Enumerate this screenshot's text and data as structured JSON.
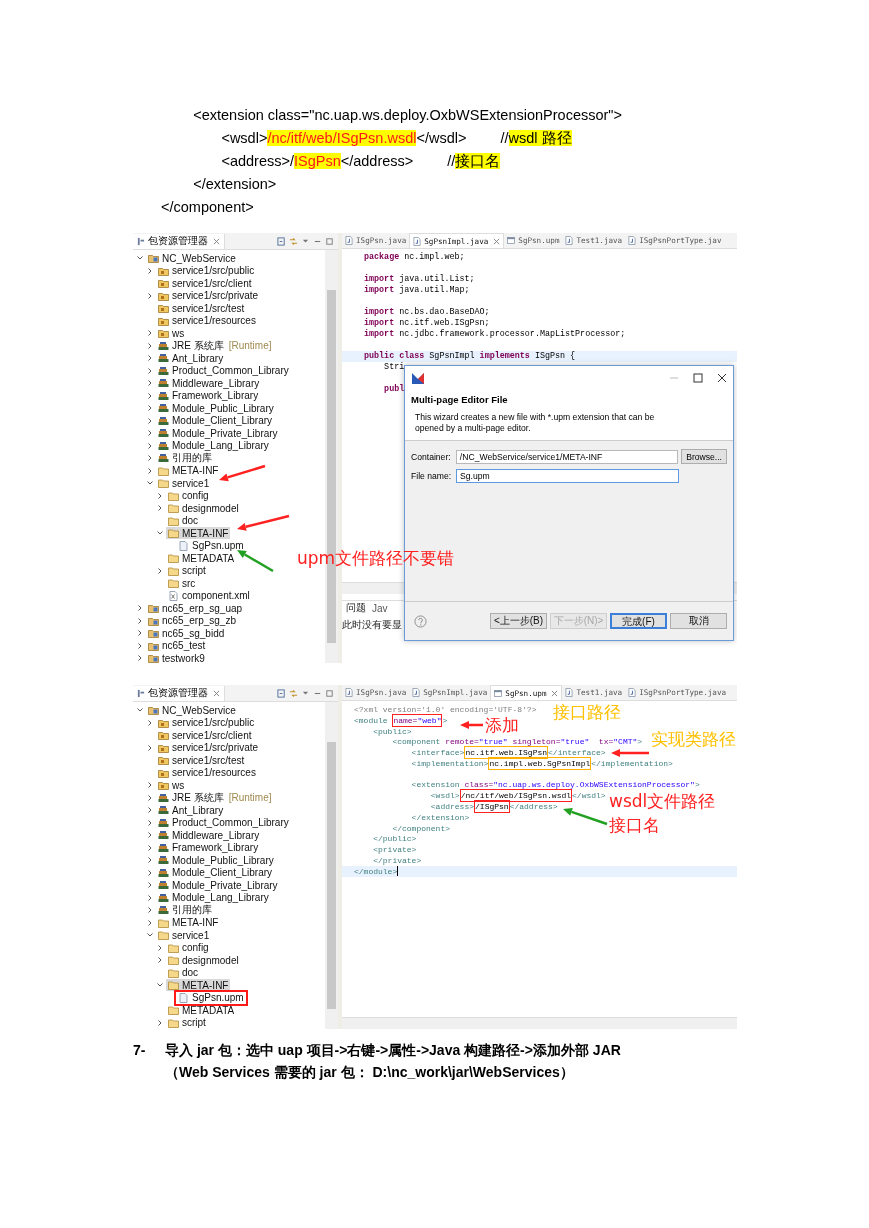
{
  "snippet": [
    {
      "segs": [
        {
          "text": "        <extension class=\"nc.uap.ws.deploy.OxbWSExtensionProcessor\">",
          "kind": "code"
        }
      ]
    },
    {
      "segs": [
        {
          "text": "               <wsdl>",
          "kind": "code"
        },
        {
          "text": "/nc/itf/web/ISgPsn.wsdl",
          "kind": "red"
        },
        {
          "text": "</wsdl>",
          "kind": "code"
        }
      ],
      "note": [
        {
          "text": "//",
          "kind": "code"
        },
        {
          "text": "wsdl 路径",
          "kind": "mark"
        }
      ]
    },
    {
      "segs": [
        {
          "text": "               <address>/",
          "kind": "code"
        },
        {
          "text": "ISgPsn",
          "kind": "red"
        },
        {
          "text": "</address>",
          "kind": "code"
        }
      ],
      "note": [
        {
          "text": "//",
          "kind": "code"
        },
        {
          "text": "接口名",
          "kind": "mark"
        }
      ]
    },
    {
      "segs": [
        {
          "text": "        </extension>",
          "kind": "code"
        }
      ]
    },
    {
      "segs": [
        {
          "text": "</component>",
          "kind": "code"
        }
      ]
    }
  ],
  "shot1": {
    "explorer_title": "包资源管理器",
    "tree": [
      {
        "label": "NC_WebService",
        "kind": "project",
        "expanded": true,
        "selected": false,
        "children": [
          {
            "label": "service1/src/public",
            "kind": "source-folder",
            "expanded": false,
            "selected": false
          },
          {
            "label": "service1/src/client",
            "kind": "source-folder",
            "selected": false
          },
          {
            "label": "service1/src/private",
            "kind": "source-folder",
            "expanded": false,
            "selected": false
          },
          {
            "label": "service1/src/test",
            "kind": "source-folder",
            "selected": false
          },
          {
            "label": "service1/resources",
            "kind": "source-folder",
            "selected": false
          },
          {
            "label": "ws",
            "kind": "source-folder",
            "expanded": false,
            "selected": false
          },
          {
            "label": "JRE 系统库",
            "decoration": "[Runtime]",
            "kind": "library",
            "expanded": false,
            "selected": false
          },
          {
            "label": "Ant_Library",
            "kind": "library",
            "expanded": false,
            "selected": false
          },
          {
            "label": "Product_Common_Library",
            "kind": "library",
            "expanded": false,
            "selected": false
          },
          {
            "label": "Middleware_Library",
            "kind": "library",
            "expanded": false,
            "selected": false
          },
          {
            "label": "Framework_Library",
            "kind": "library",
            "expanded": false,
            "selected": false
          },
          {
            "label": "Module_Public_Library",
            "kind": "library",
            "expanded": false,
            "selected": false
          },
          {
            "label": "Module_Client_Library",
            "kind": "library",
            "expanded": false,
            "selected": false
          },
          {
            "label": "Module_Private_Library",
            "kind": "library",
            "expanded": false,
            "selected": false
          },
          {
            "label": "Module_Lang_Library",
            "kind": "library",
            "expanded": false,
            "selected": false
          },
          {
            "label": "引用的库",
            "kind": "library",
            "expanded": false,
            "selected": false
          },
          {
            "label": "META-INF",
            "kind": "folder",
            "expanded": false,
            "selected": false
          },
          {
            "label": "service1",
            "kind": "folder",
            "expanded": true,
            "selected": false,
            "children": [
              {
                "label": "config",
                "kind": "folder",
                "expanded": false,
                "selected": false
              },
              {
                "label": "designmodel",
                "kind": "folder",
                "expanded": false,
                "selected": false
              },
              {
                "label": "doc",
                "kind": "folder",
                "selected": false
              },
              {
                "label": "META-INF",
                "kind": "folder",
                "expanded": true,
                "selected": true,
                "children": [
                  {
                    "label": "SgPsn.upm",
                    "kind": "file",
                    "selected": false
                  }
                ]
              },
              {
                "label": "METADATA",
                "kind": "folder",
                "selected": false
              },
              {
                "label": "script",
                "kind": "folder",
                "expanded": false,
                "selected": false
              },
              {
                "label": "src",
                "kind": "folder",
                "selected": false
              },
              {
                "label": "component.xml",
                "kind": "xml-file",
                "selected": false
              }
            ]
          }
        ]
      },
      {
        "label": "nc65_erp_sg_uap",
        "kind": "project",
        "expanded": false,
        "selected": false
      },
      {
        "label": "nc65_erp_sg_zb",
        "kind": "project",
        "expanded": false,
        "selected": false
      },
      {
        "label": "nc65_sg_bidd",
        "kind": "project",
        "expanded": false,
        "selected": false
      },
      {
        "label": "nc65_test",
        "kind": "project",
        "expanded": false,
        "selected": false
      },
      {
        "label": "testwork9",
        "kind": "project",
        "expanded": false,
        "selected": false
      }
    ],
    "tabs": [
      {
        "label": "ISgPsn.java",
        "kind": "java",
        "selected": false
      },
      {
        "label": "SgPsnImpl.java",
        "kind": "java",
        "selected": true
      },
      {
        "label": "SgPsn.upm",
        "kind": "upm",
        "selected": false
      },
      {
        "label": "Test1.java",
        "kind": "java",
        "selected": false
      },
      {
        "label": "ISgPsnPortType.jav",
        "kind": "java",
        "selected": false
      }
    ],
    "code": [
      {
        "current": false,
        "segs": [
          {
            "text": "package",
            "kind": "kw"
          },
          {
            "text": " nc.impl.web;",
            "kind": "plain"
          }
        ]
      },
      {
        "current": false
      },
      {
        "current": false,
        "segs": [
          {
            "text": "import",
            "kind": "kw"
          },
          {
            "text": " java.util.List;",
            "kind": "plain"
          }
        ]
      },
      {
        "current": false,
        "segs": [
          {
            "text": "import",
            "kind": "kw"
          },
          {
            "text": " java.util.Map;",
            "kind": "plain"
          }
        ]
      },
      {
        "current": false
      },
      {
        "current": false,
        "segs": [
          {
            "text": "import",
            "kind": "kw"
          },
          {
            "text": " nc.bs.dao.BaseDAO;",
            "kind": "plain"
          }
        ]
      },
      {
        "current": false,
        "segs": [
          {
            "text": "import",
            "kind": "kw"
          },
          {
            "text": " nc.itf.web.ISgPsn;",
            "kind": "plain"
          }
        ]
      },
      {
        "current": false,
        "segs": [
          {
            "text": "import",
            "kind": "kw"
          },
          {
            "text": " nc.jdbc.framework.processor.MapListProcessor;",
            "kind": "plain"
          }
        ]
      },
      {
        "current": false
      },
      {
        "current": true,
        "segs": [
          {
            "text": "public class",
            "kind": "kw"
          },
          {
            "text": " SgPsnImpl ",
            "kind": "plain"
          },
          {
            "text": "implements",
            "kind": "kw"
          },
          {
            "text": " ISgPsn {",
            "kind": "plain"
          }
        ]
      },
      {
        "current": false,
        "segs": [
          {
            "text": "    Stri",
            "kind": "plain"
          }
        ]
      },
      {
        "current": false
      },
      {
        "current": false,
        "segs": [
          {
            "text": "    publ",
            "kind": "kw"
          }
        ]
      }
    ],
    "problems": {
      "tabs": [
        {
          "label": "问题",
          "selected": true
        },
        {
          "label": "Jav",
          "selected": false
        }
      ],
      "message": "此时没有要显"
    },
    "dialog": {
      "heading": "Multi-page Editor File",
      "description": "This wizard creates a new file with *.upm extension that can be opened by a multi-page editor.",
      "fields": [
        {
          "label": "Container:",
          "value": "/NC_WebService/service1/META-INF",
          "focused": false
        },
        {
          "label": "File name:",
          "value": "Sg.upm",
          "focused": true
        }
      ],
      "browse": "Browse...",
      "buttons": [
        {
          "label": "<上一步(B)",
          "disabled": false,
          "default": false
        },
        {
          "label": "下一步(N)>",
          "disabled": true,
          "default": false
        },
        {
          "label": "完成(F)",
          "disabled": false,
          "default": true
        },
        {
          "label": "取消",
          "disabled": false,
          "default": false
        }
      ]
    },
    "annotations": [
      {
        "text": "upm文件路径不要错",
        "color": "#ff2020"
      }
    ]
  },
  "shot2": {
    "explorer_title": "包资源管理器",
    "tree": [
      {
        "label": "NC_WebService",
        "kind": "project",
        "expanded": true,
        "selected": false,
        "children": [
          {
            "label": "service1/src/public",
            "kind": "source-folder",
            "expanded": false,
            "selected": false
          },
          {
            "label": "service1/src/client",
            "kind": "source-folder",
            "selected": false
          },
          {
            "label": "service1/src/private",
            "kind": "source-folder",
            "expanded": false,
            "selected": false
          },
          {
            "label": "service1/src/test",
            "kind": "source-folder",
            "selected": false
          },
          {
            "label": "service1/resources",
            "kind": "source-folder",
            "selected": false
          },
          {
            "label": "ws",
            "kind": "source-folder",
            "expanded": false,
            "selected": false
          },
          {
            "label": "JRE 系统库",
            "decoration": "[Runtime]",
            "kind": "library",
            "expanded": false,
            "selected": false
          },
          {
            "label": "Ant_Library",
            "kind": "library",
            "expanded": false,
            "selected": false
          },
          {
            "label": "Product_Common_Library",
            "kind": "library",
            "expanded": false,
            "selected": false
          },
          {
            "label": "Middleware_Library",
            "kind": "library",
            "expanded": false,
            "selected": false
          },
          {
            "label": "Framework_Library",
            "kind": "library",
            "expanded": false,
            "selected": false
          },
          {
            "label": "Module_Public_Library",
            "kind": "library",
            "expanded": false,
            "selected": false
          },
          {
            "label": "Module_Client_Library",
            "kind": "library",
            "expanded": false,
            "selected": false
          },
          {
            "label": "Module_Private_Library",
            "kind": "library",
            "expanded": false,
            "selected": false
          },
          {
            "label": "Module_Lang_Library",
            "kind": "library",
            "expanded": false,
            "selected": false
          },
          {
            "label": "引用的库",
            "kind": "library",
            "expanded": false,
            "selected": false
          },
          {
            "label": "META-INF",
            "kind": "folder",
            "expanded": false,
            "selected": false
          },
          {
            "label": "service1",
            "kind": "folder",
            "expanded": true,
            "selected": false,
            "children": [
              {
                "label": "config",
                "kind": "folder",
                "expanded": false,
                "selected": false
              },
              {
                "label": "designmodel",
                "kind": "folder",
                "expanded": false,
                "selected": false
              },
              {
                "label": "doc",
                "kind": "folder",
                "selected": false
              },
              {
                "label": "META-INF",
                "kind": "folder",
                "expanded": true,
                "selected": true,
                "children": [
                  {
                    "label": "SgPsn.upm",
                    "kind": "file",
                    "selected": false,
                    "boxed": true
                  }
                ]
              },
              {
                "label": "METADATA",
                "kind": "folder",
                "selected": false
              },
              {
                "label": "script",
                "kind": "folder",
                "expanded": false,
                "selected": false
              }
            ]
          }
        ]
      }
    ],
    "tabs": [
      {
        "label": "ISgPsn.java",
        "kind": "java",
        "selected": false
      },
      {
        "label": "SgPsnImpl.java",
        "kind": "java",
        "selected": false
      },
      {
        "label": "SgPsn.upm",
        "kind": "upm",
        "selected": true
      },
      {
        "label": "Test1.java",
        "kind": "java",
        "selected": false
      },
      {
        "label": "ISgPsnPortType.java",
        "kind": "java",
        "selected": false
      }
    ],
    "code": [
      {
        "current": false,
        "segs": [
          {
            "text": "<?xml version='1.0' encoding='UTF-8'?>",
            "kind": "decl"
          }
        ]
      },
      {
        "current": false,
        "segs": [
          {
            "text": "<module ",
            "kind": "tag"
          },
          {
            "color": "#ff2020",
            "parts": [
              {
                "text": "name=",
                "kind": "attr"
              },
              {
                "text": "\"web\"",
                "kind": "val"
              }
            ]
          },
          {
            "text": ">",
            "kind": "tag"
          }
        ]
      },
      {
        "current": false,
        "segs": [
          {
            "text": "    <public>",
            "kind": "tag"
          }
        ]
      },
      {
        "current": false,
        "segs": [
          {
            "text": "        <component ",
            "kind": "tag"
          },
          {
            "text": "remote=",
            "kind": "attr"
          },
          {
            "text": "\"true\"",
            "kind": "val"
          },
          {
            "text": " singleton=",
            "kind": "attr"
          },
          {
            "text": "\"true\"",
            "kind": "val"
          },
          {
            "text": "  tx=",
            "kind": "attr"
          },
          {
            "text": "\"CMT\"",
            "kind": "val"
          },
          {
            "text": ">",
            "kind": "tag"
          }
        ]
      },
      {
        "current": false,
        "segs": [
          {
            "text": "            <interface>",
            "kind": "tag"
          },
          {
            "color": "#ffb000",
            "parts": [
              {
                "text": "nc.itf.web.ISgPsn",
                "kind": "text"
              }
            ]
          },
          {
            "text": "</interface>",
            "kind": "tag"
          }
        ]
      },
      {
        "current": false,
        "segs": [
          {
            "text": "            <implementation>",
            "kind": "tag"
          },
          {
            "color": "#ffb000",
            "parts": [
              {
                "text": "nc.impl.web.SgPsnImpl",
                "kind": "text"
              }
            ]
          },
          {
            "text": "</implementation>",
            "kind": "tag"
          }
        ]
      },
      {
        "current": false
      },
      {
        "current": false,
        "segs": [
          {
            "text": "            <extension ",
            "kind": "tag"
          },
          {
            "text": "class=",
            "kind": "attr"
          },
          {
            "text": "\"nc.uap.ws.deploy.OxbWSExtensionProcessor\"",
            "kind": "val"
          },
          {
            "text": ">",
            "kind": "tag"
          }
        ]
      },
      {
        "current": false,
        "segs": [
          {
            "text": "                <wsdl>",
            "kind": "tag"
          },
          {
            "color": "#ff2020",
            "parts": [
              {
                "text": "/nc/itf/web/ISgPsn.wsdl",
                "kind": "text"
              }
            ]
          },
          {
            "text": "</wsdl>",
            "kind": "tag"
          }
        ]
      },
      {
        "current": false,
        "segs": [
          {
            "text": "                <address>",
            "kind": "tag"
          },
          {
            "color": "#ff2020",
            "parts": [
              {
                "text": "/ISgPsn",
                "kind": "text"
              }
            ]
          },
          {
            "text": "</address>",
            "kind": "tag"
          }
        ]
      },
      {
        "current": false,
        "segs": [
          {
            "text": "            </extension>",
            "kind": "tag"
          }
        ]
      },
      {
        "current": false,
        "segs": [
          {
            "text": "        </component>",
            "kind": "tag"
          }
        ]
      },
      {
        "current": false,
        "segs": [
          {
            "text": "    </public>",
            "kind": "tag"
          }
        ]
      },
      {
        "current": false,
        "segs": [
          {
            "text": "    <private>",
            "kind": "tag"
          }
        ]
      },
      {
        "current": false,
        "segs": [
          {
            "text": "    </private>",
            "kind": "tag"
          }
        ]
      },
      {
        "current": true,
        "segs": [
          {
            "text": "</module>",
            "kind": "tag"
          }
        ]
      }
    ],
    "annotations": [
      {
        "text": "添加",
        "color": "#ff2020"
      },
      {
        "text": "接口路径",
        "color": "#ffc000"
      },
      {
        "text": "实现类路径",
        "color": "#ffc000"
      },
      {
        "text": "wsdl文件路径",
        "color": "#ff2020"
      },
      {
        "text": "接口名",
        "color": "#ff2020"
      }
    ]
  },
  "step": {
    "number": "7-",
    "lines": [
      "导入 jar 包：选中 uap 项目->右键->属性->Java 构建路径->添加外部 JAR",
      "（Web Services 需要的 jar 包：  D:\\nc_work\\jar\\WebServices）"
    ]
  }
}
